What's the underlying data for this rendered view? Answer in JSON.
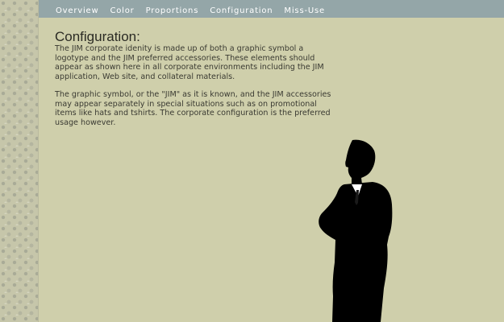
{
  "nav": {
    "items": [
      "Overview",
      "Color",
      "Proportions",
      "Configuration",
      "Miss-Use"
    ]
  },
  "main": {
    "title": "Configuration:",
    "paragraphs": [
      "The JIM corporate idenity is made up of both a graphic symbol a logotype and the JIM preferred accessories. These elements should appear as shown here in all corporate environments including the JIM application, Web site, and collateral materials.",
      "The graphic symbol, or the \"JIM\" as it is known, and the JIM accessories may appear separately in special situations such as on promotional items like hats and tshirts. The corporate configuration is the preferred usage however."
    ]
  },
  "colors": {
    "page_background": "#cfcfab",
    "topbar": "#94a6a8",
    "nav_text": "#ffffff",
    "silhouette": "#000000"
  },
  "figure": {
    "icon": "man-silhouette-icon"
  }
}
